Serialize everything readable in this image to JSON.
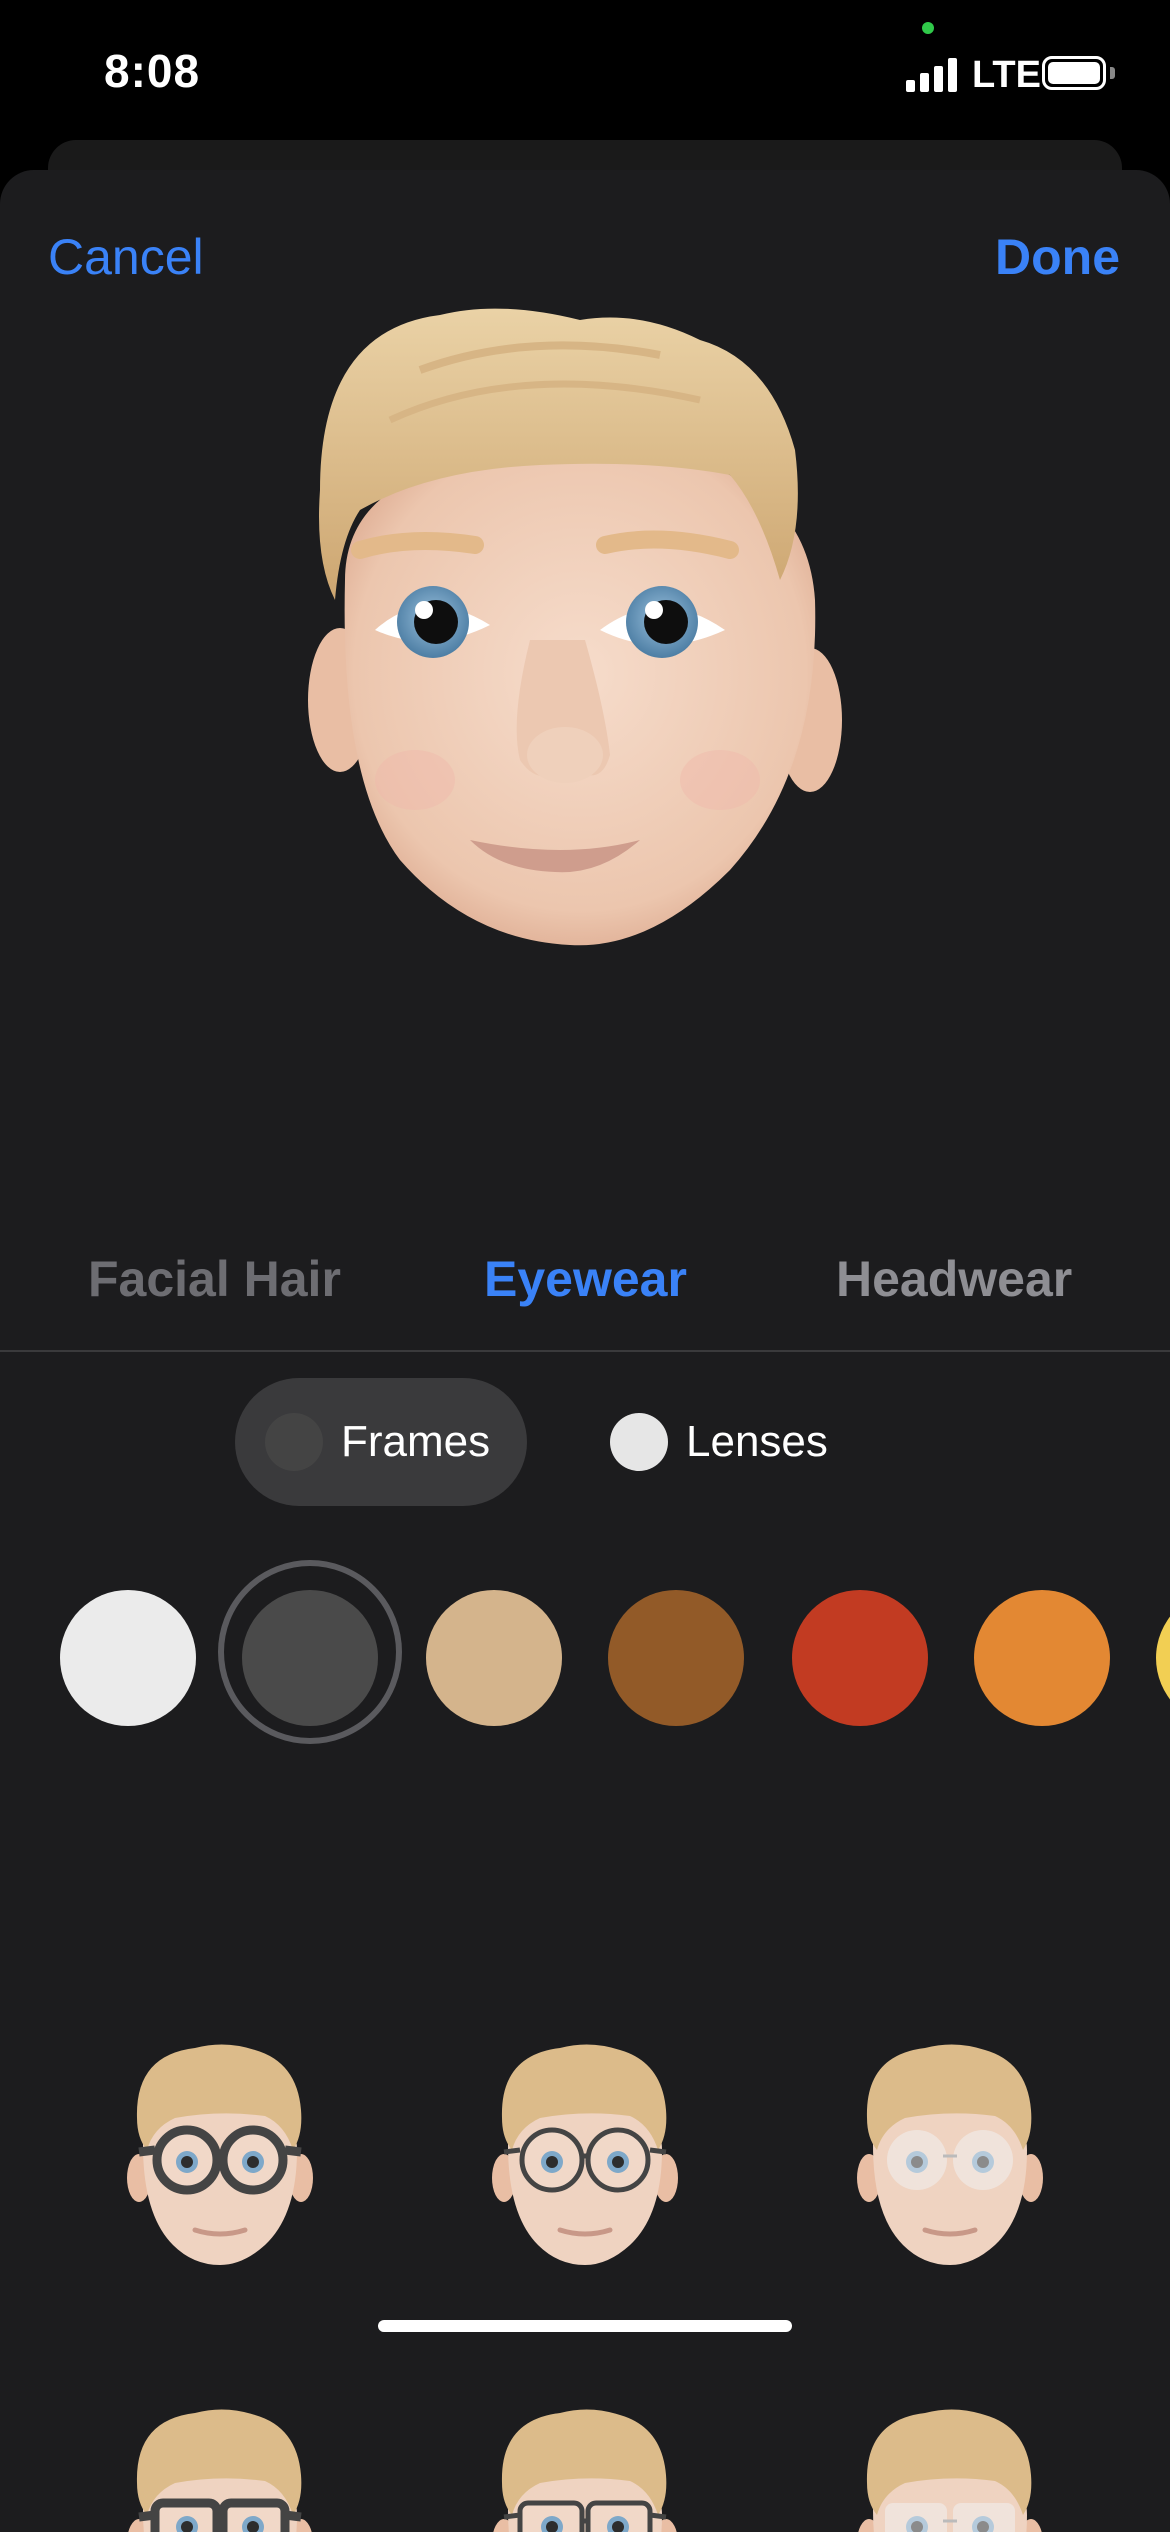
{
  "status": {
    "time": "8:08",
    "network": "LTE"
  },
  "nav": {
    "cancel": "Cancel",
    "done": "Done"
  },
  "categories": [
    "Facial Hair",
    "Eyewear",
    "Headwear"
  ],
  "segments": {
    "frames": "Frames",
    "lenses": "Lenses"
  },
  "colors": {
    "accent": "#3a82f7",
    "swatches": [
      "#ebebeb",
      "#4a4a4a",
      "#d4b48c",
      "#925a28",
      "#c23b22",
      "#e38833",
      "#f2cf53"
    ],
    "selected_swatch_index": 1
  },
  "eyewear_options": [
    {
      "style": "thick-round"
    },
    {
      "style": "thin-round"
    },
    {
      "style": "rimless-round"
    },
    {
      "style": "thick-rect"
    },
    {
      "style": "thin-rect"
    },
    {
      "style": "rimless-rect"
    }
  ]
}
